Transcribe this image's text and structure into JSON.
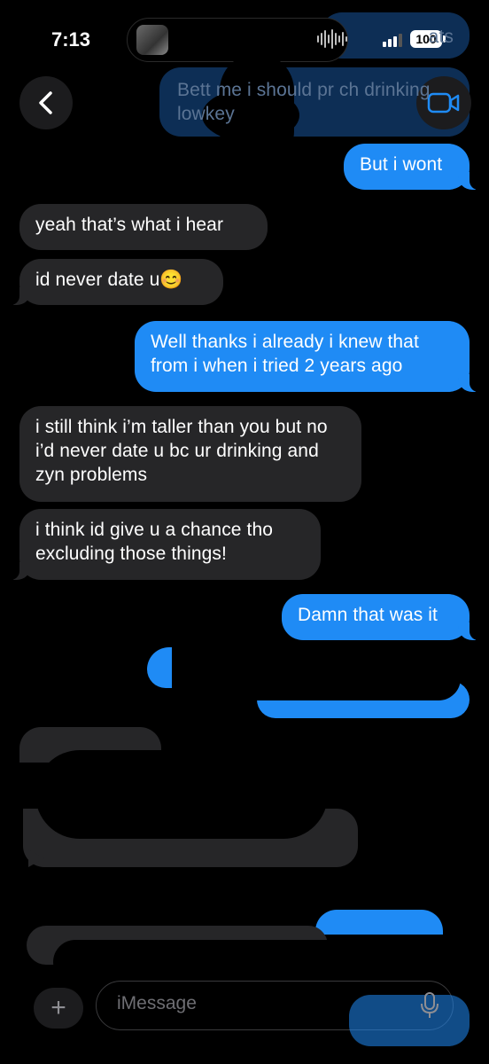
{
  "status_bar": {
    "time": "7:13",
    "battery": "100",
    "signal_bars": 3
  },
  "header": {
    "back_icon": "chevron-left-icon",
    "video_icon": "video-camera-icon"
  },
  "messages": [
    {
      "id": "m1",
      "from": "me",
      "text": "ats",
      "partially_hidden": true
    },
    {
      "id": "m2",
      "from": "me",
      "text": "Bett me i should pr ch drinking lowkey",
      "partially_hidden": true
    },
    {
      "id": "m3",
      "from": "me",
      "text": "But i wont"
    },
    {
      "id": "m4",
      "from": "them",
      "text": "yeah that’s what i hear"
    },
    {
      "id": "m5",
      "from": "them",
      "text": "id never date u😊"
    },
    {
      "id": "m6",
      "from": "me",
      "text": "Well thanks i already i knew that from i when i tried 2 years ago"
    },
    {
      "id": "m7",
      "from": "them",
      "text": "i still think i’m taller than you but no i’d never date u bc ur drinking and zyn problems"
    },
    {
      "id": "m8",
      "from": "them",
      "text": "i think id give u a chance tho excluding those things!"
    },
    {
      "id": "m9",
      "from": "me",
      "text": "Damn that was it"
    }
  ],
  "composer": {
    "placeholder": "iMessage",
    "plus_icon": "plus-icon",
    "mic_icon": "microphone-icon"
  },
  "colors": {
    "sent_bubble": "#1f8bf5",
    "received_bubble": "#262628",
    "background": "#000000"
  }
}
